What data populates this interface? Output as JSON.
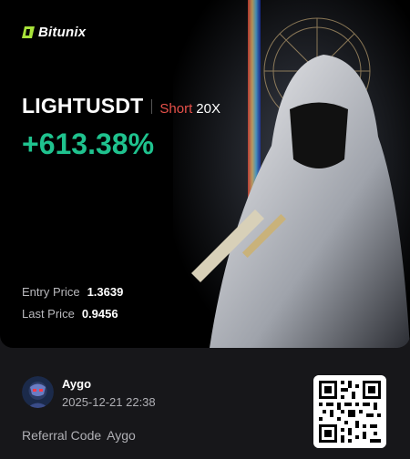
{
  "brand": {
    "name": "Bitunix",
    "accent": "#a8e23a"
  },
  "trade": {
    "pair": "LIGHTUSDT",
    "side": "Short",
    "leverage": "20X",
    "pnl_percent": "+613.38%",
    "entry_label": "Entry Price",
    "entry_value": "1.3639",
    "last_label": "Last Price",
    "last_value": "0.9456"
  },
  "colors": {
    "profit": "#1fc28e",
    "short": "#e8514a"
  },
  "user": {
    "name": "Aygo",
    "timestamp": "2025-12-21 22:38",
    "referral_label": "Referral Code",
    "referral_code": "Aygo"
  }
}
